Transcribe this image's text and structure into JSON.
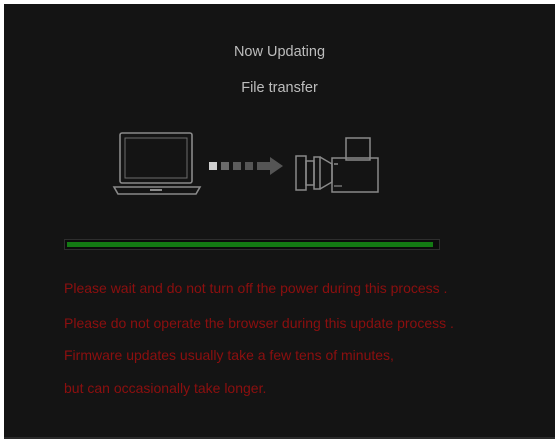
{
  "dialog": {
    "title": "Now Updating",
    "subtitle": "File transfer"
  },
  "icons": {
    "source": "laptop-icon",
    "transfer": "transfer-arrow-icon",
    "target": "video-camera-icon"
  },
  "progress": {
    "fraction": 0.99
  },
  "messages": [
    "Please wait and do not turn off the power during this process .",
    "Please do not operate the browser during this update process .",
    "Firmware updates usually take a few tens of minutes,",
    "but can occasionally take longer."
  ],
  "colors": {
    "background": "#141414",
    "title_text": "#bdbdbd",
    "warning_text": "#8c0f0f",
    "progress_fill": "#137a13",
    "icon_stroke": "#8a8a8a"
  }
}
